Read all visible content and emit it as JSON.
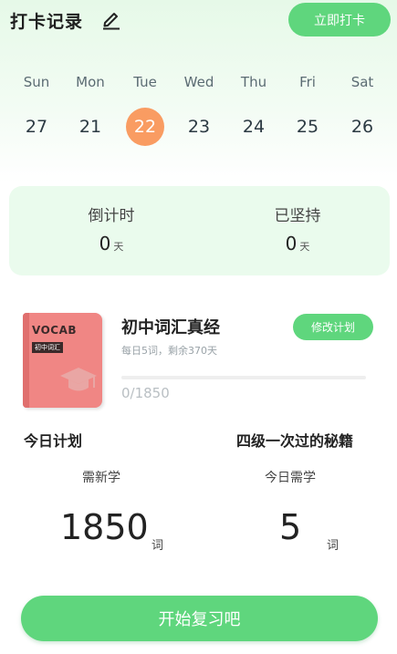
{
  "header": {
    "title": "打卡记录",
    "checkin_label": "立即打卡"
  },
  "week": {
    "days": [
      {
        "name": "Sun",
        "num": "27"
      },
      {
        "name": "Mon",
        "num": "21"
      },
      {
        "name": "Tue",
        "num": "22",
        "active": true
      },
      {
        "name": "Wed",
        "num": "23"
      },
      {
        "name": "Thu",
        "num": "24"
      },
      {
        "name": "Fri",
        "num": "25"
      },
      {
        "name": "Sat",
        "num": "26"
      }
    ]
  },
  "stats": {
    "countdown": {
      "label": "倒计时",
      "value": "0",
      "unit": "天"
    },
    "persisted": {
      "label": "已坚持",
      "value": "0",
      "unit": "天"
    }
  },
  "book": {
    "cover_title": "VOCAB",
    "cover_tag": "初中词汇",
    "title": "初中词汇真经",
    "subtitle": "每日5词，剩余370天",
    "modify_label": "修改计划",
    "progress_text": "0/1850",
    "progress": 0
  },
  "plan": {
    "title": "今日计划",
    "secret_title": "四级一次过的秘籍",
    "new_label": "需新学",
    "new_value": "1850",
    "new_unit": "词",
    "today_label": "今日需学",
    "today_value": "5",
    "today_unit": "词"
  },
  "start_label": "开始复习吧",
  "colors": {
    "accent": "#5fd67d",
    "active_day": "#f99c62",
    "card_bg": "#eafbed",
    "book_cover": "#f08684"
  }
}
